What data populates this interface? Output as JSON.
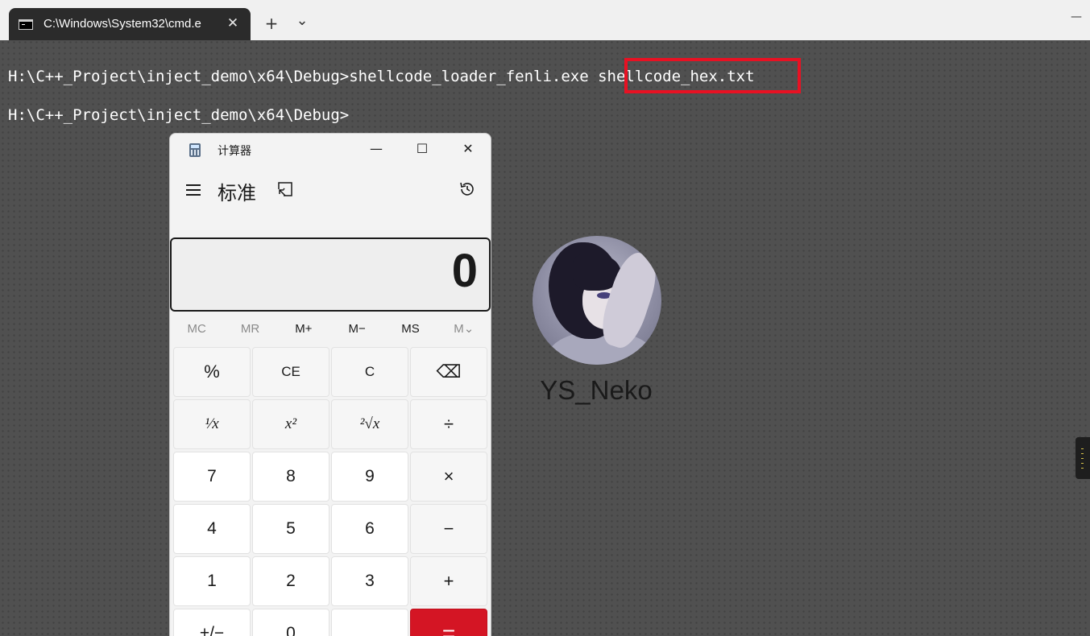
{
  "terminal": {
    "tab_title": "C:\\Windows\\System32\\cmd.e",
    "new_tab_label": "+",
    "dropdown_label": "⌄",
    "minimize_label": "—",
    "lines": [
      "H:\\C++_Project\\inject_demo\\x64\\Debug>shellcode_loader_fenli.exe shellcode_hex.txt",
      "H:\\C++_Project\\inject_demo\\x64\\Debug>"
    ],
    "highlight_color": "#e81123"
  },
  "profile": {
    "username": "YS_Neko"
  },
  "calculator": {
    "title": "计算器",
    "mode": "标准",
    "display_value": "0",
    "window_buttons": {
      "minimize": "—",
      "maximize": "☐",
      "close": "✕"
    },
    "memory": [
      {
        "label": "MC",
        "enabled": false
      },
      {
        "label": "MR",
        "enabled": false
      },
      {
        "label": "M+",
        "enabled": true
      },
      {
        "label": "M−",
        "enabled": true
      },
      {
        "label": "MS",
        "enabled": true
      },
      {
        "label": "M⌄",
        "enabled": false
      }
    ],
    "keys": [
      {
        "label": "%",
        "type": "op"
      },
      {
        "label": "CE",
        "type": "op"
      },
      {
        "label": "C",
        "type": "op"
      },
      {
        "label": "⌫",
        "type": "op"
      },
      {
        "label": "¹⁄x",
        "type": "op"
      },
      {
        "label": "x²",
        "type": "op"
      },
      {
        "label": "²√x",
        "type": "op"
      },
      {
        "label": "÷",
        "type": "op"
      },
      {
        "label": "7",
        "type": "num"
      },
      {
        "label": "8",
        "type": "num"
      },
      {
        "label": "9",
        "type": "num"
      },
      {
        "label": "×",
        "type": "op"
      },
      {
        "label": "4",
        "type": "num"
      },
      {
        "label": "5",
        "type": "num"
      },
      {
        "label": "6",
        "type": "num"
      },
      {
        "label": "−",
        "type": "op"
      },
      {
        "label": "1",
        "type": "num"
      },
      {
        "label": "2",
        "type": "num"
      },
      {
        "label": "3",
        "type": "num"
      },
      {
        "label": "+",
        "type": "op"
      },
      {
        "label": "+/−",
        "type": "num"
      },
      {
        "label": "0",
        "type": "num"
      },
      {
        "label": ".",
        "type": "num"
      },
      {
        "label": "=",
        "type": "eq"
      }
    ],
    "accent_color": "#d41524"
  }
}
